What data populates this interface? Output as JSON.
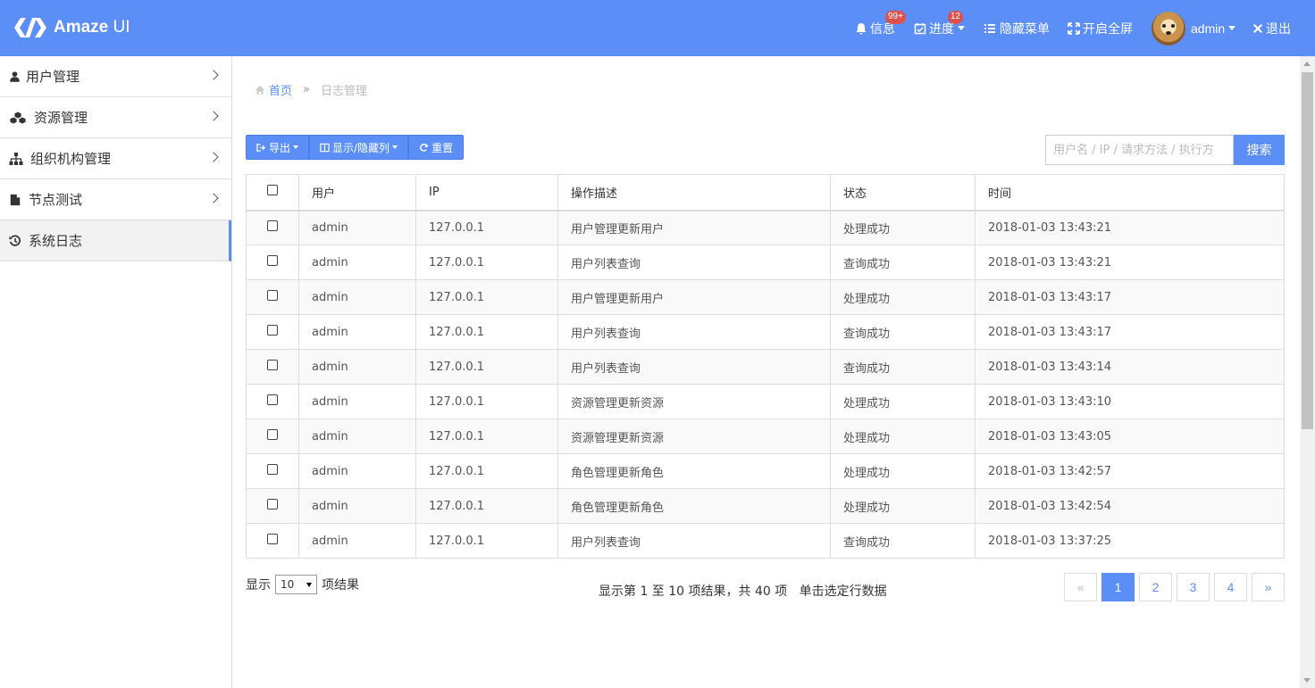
{
  "brand": {
    "name_bold": "Amaze",
    "name_light": "UI"
  },
  "topnav": {
    "messages": {
      "label": "信息",
      "badge": "99+"
    },
    "progress": {
      "label": "进度",
      "badge": "12"
    },
    "hide_menu": "隐藏菜单",
    "fullscreen": "开启全屏",
    "user": "admin",
    "logout": "退出"
  },
  "sidebar": {
    "items": [
      {
        "label": "用户管理",
        "icon": "user-icon"
      },
      {
        "label": "资源管理",
        "icon": "cubes-icon"
      },
      {
        "label": "组织机构管理",
        "icon": "sitemap-icon"
      },
      {
        "label": "节点测试",
        "icon": "file-icon"
      },
      {
        "label": "系统日志",
        "icon": "history-icon"
      }
    ],
    "active_index": 4
  },
  "breadcrumb": {
    "home": "首页",
    "separator": "»",
    "current": "日志管理"
  },
  "toolbar": {
    "export": "导出",
    "columns": "显示/隐藏列",
    "reset": "重置"
  },
  "search": {
    "placeholder": "用户名 / IP / 请求方法 / 执行方",
    "button": "搜索"
  },
  "table": {
    "columns": [
      "用户",
      "IP",
      "操作描述",
      "状态",
      "时间"
    ],
    "rows": [
      [
        "admin",
        "127.0.0.1",
        "用户管理更新用户",
        "处理成功",
        "2018-01-03 13:43:21"
      ],
      [
        "admin",
        "127.0.0.1",
        "用户列表查询",
        "查询成功",
        "2018-01-03 13:43:21"
      ],
      [
        "admin",
        "127.0.0.1",
        "用户管理更新用户",
        "处理成功",
        "2018-01-03 13:43:17"
      ],
      [
        "admin",
        "127.0.0.1",
        "用户列表查询",
        "查询成功",
        "2018-01-03 13:43:17"
      ],
      [
        "admin",
        "127.0.0.1",
        "用户列表查询",
        "查询成功",
        "2018-01-03 13:43:14"
      ],
      [
        "admin",
        "127.0.0.1",
        "资源管理更新资源",
        "处理成功",
        "2018-01-03 13:43:10"
      ],
      [
        "admin",
        "127.0.0.1",
        "资源管理更新资源",
        "处理成功",
        "2018-01-03 13:43:05"
      ],
      [
        "admin",
        "127.0.0.1",
        "角色管理更新角色",
        "处理成功",
        "2018-01-03 13:42:57"
      ],
      [
        "admin",
        "127.0.0.1",
        "角色管理更新角色",
        "处理成功",
        "2018-01-03 13:42:54"
      ],
      [
        "admin",
        "127.0.0.1",
        "用户列表查询",
        "查询成功",
        "2018-01-03 13:37:25"
      ]
    ]
  },
  "footer": {
    "show_prefix": "显示",
    "page_size": "10",
    "show_suffix": "项结果",
    "info": "显示第 1 至 10 项结果，共 40 项   单击选定行数据"
  },
  "pagination": {
    "prev": "«",
    "pages": [
      "1",
      "2",
      "3",
      "4"
    ],
    "active": "1",
    "next": "»"
  },
  "colors": {
    "primary": "#5b8ef7",
    "badge": "#dd514c"
  }
}
